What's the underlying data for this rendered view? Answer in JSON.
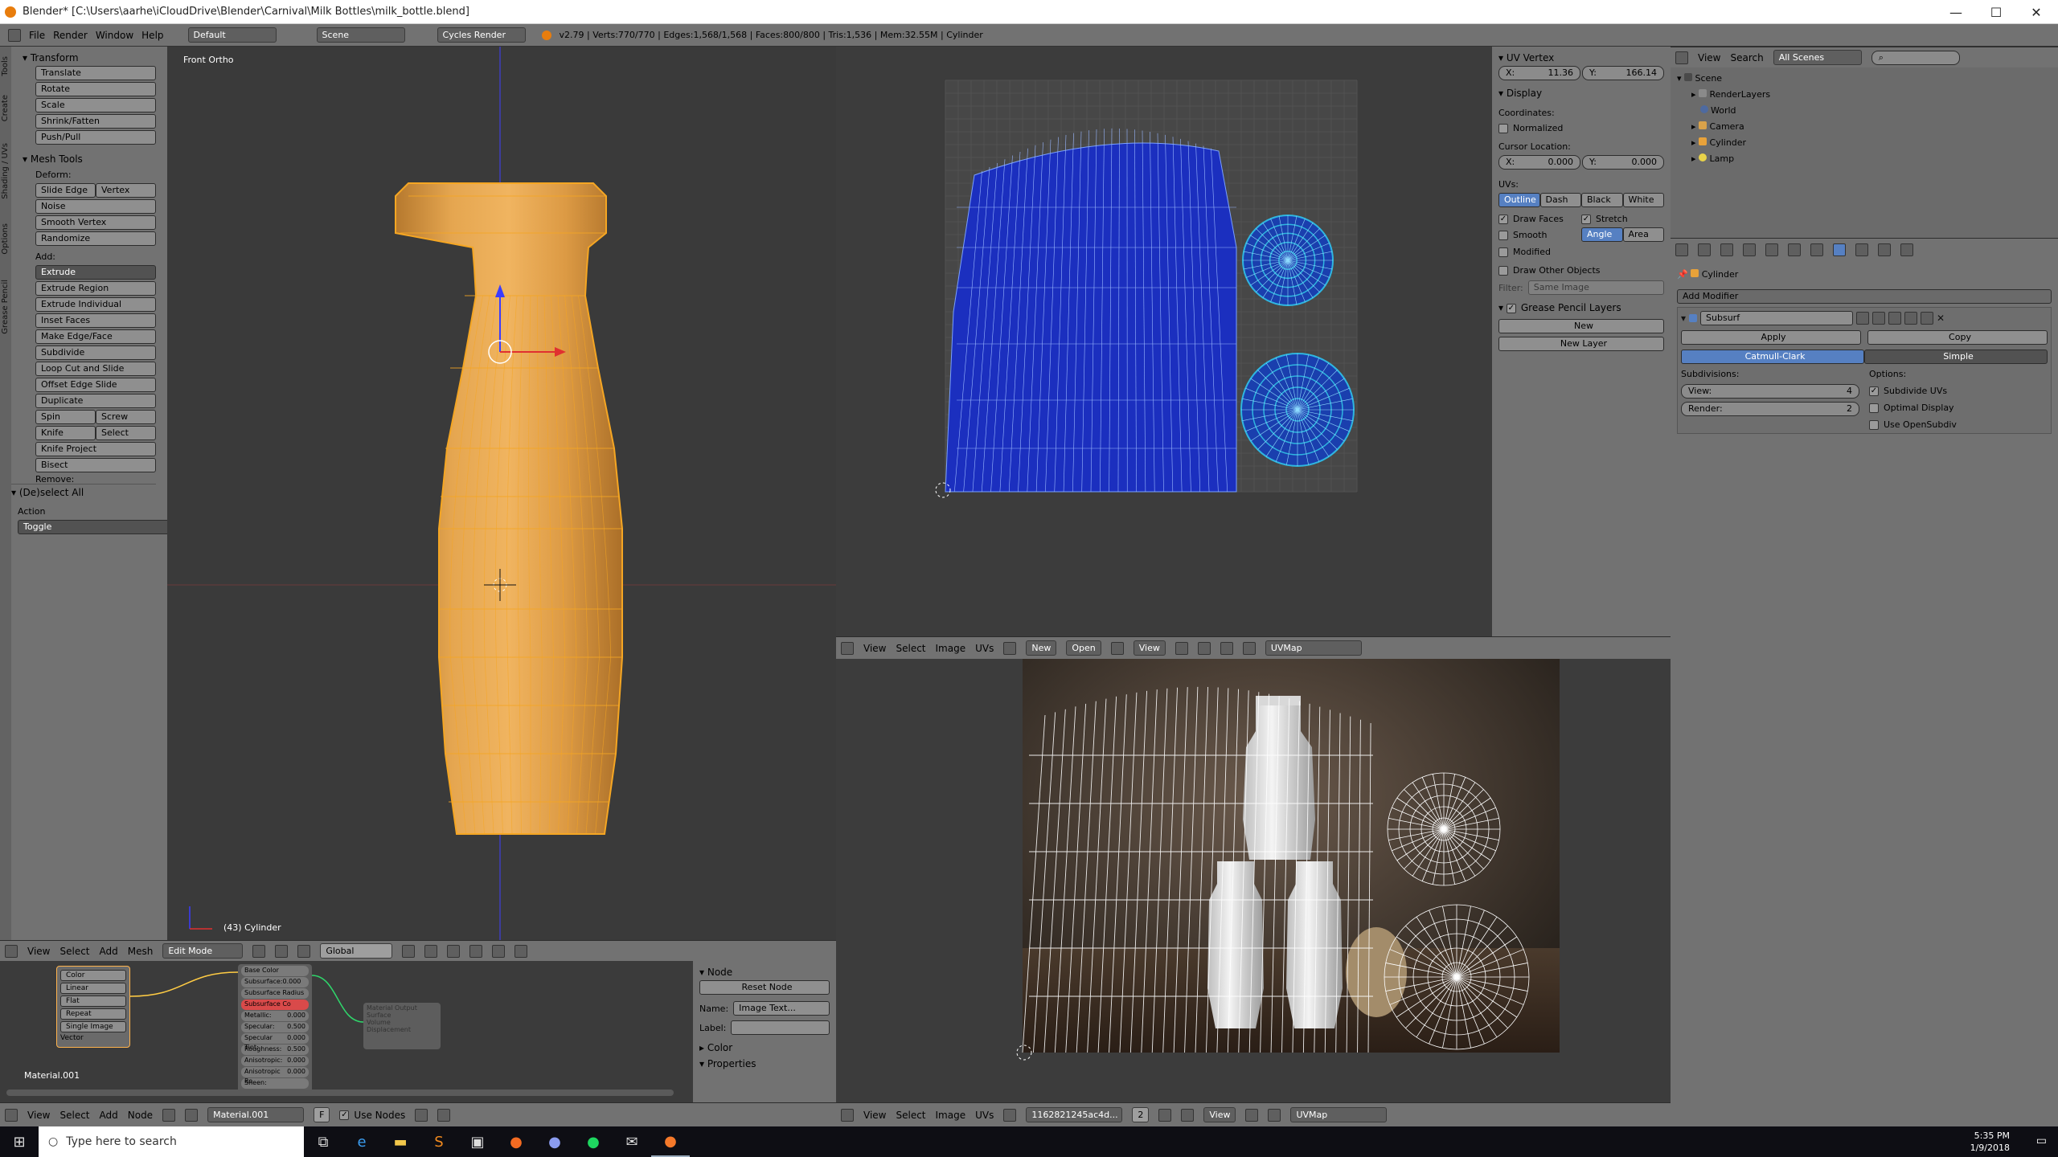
{
  "window": {
    "title": "Blender* [C:\\Users\\aarhe\\iCloudDrive\\Blender\\Carnival\\Milk Bottles\\milk_bottle.blend]",
    "minimize": "—",
    "maximize": "☐",
    "close": "✕"
  },
  "infobar": {
    "menus": [
      "File",
      "Render",
      "Window",
      "Help"
    ],
    "layout": "Default",
    "scene": "Scene",
    "engine": "Cycles Render",
    "stats": "v2.79 | Verts:770/770 | Edges:1,568/1,568 | Faces:800/800 | Tris:1,536 | Mem:32.55M | Cylinder"
  },
  "tool_shelf": {
    "tabs": [
      "Tools",
      "Create",
      "Shading / UVs",
      "Options",
      "Grease Pencil"
    ],
    "transform_header": "Transform",
    "transform_items": [
      "Translate",
      "Rotate",
      "Scale",
      "Shrink/Fatten",
      "Push/Pull"
    ],
    "mesh_tools_header": "Mesh Tools",
    "deform_label": "Deform:",
    "slide_edge": "Slide Edge",
    "vertex": "Vertex",
    "deform_items": [
      "Noise",
      "Smooth Vertex",
      "Randomize"
    ],
    "add_label": "Add:",
    "extrude": "Extrude",
    "add_items": [
      "Extrude Region",
      "Extrude Individual",
      "Inset Faces",
      "Make Edge/Face",
      "Subdivide",
      "Loop Cut and Slide",
      "Offset Edge Slide",
      "Duplicate"
    ],
    "spin": "Spin",
    "screw": "Screw",
    "knife": "Knife",
    "select": "Select",
    "knife_project": "Knife Project",
    "bisect": "Bisect",
    "remove": "Remove:",
    "operator_header": "(De)select All",
    "action_label": "Action",
    "action_value": "Toggle"
  },
  "viewport3d": {
    "view_label": "Front Ortho",
    "object_label": "(43) Cylinder",
    "header_menus": [
      "View",
      "Select",
      "Add",
      "Mesh"
    ],
    "mode": "Edit Mode",
    "orientation": "Global"
  },
  "uv_props": {
    "uv_vertex_header": "UV Vertex",
    "x_label": "X:",
    "x_value": "11.36",
    "y_label": "Y:",
    "y_value": "166.14",
    "display_header": "Display",
    "coordinates_label": "Coordinates:",
    "normalized": "Normalized",
    "cursor_label": "Cursor Location:",
    "cursor_x": "0.000",
    "cursor_y": "0.000",
    "uvs_label": "UVs:",
    "uv_styles": [
      "Outline",
      "Dash",
      "Black",
      "White"
    ],
    "draw_faces": "Draw Faces",
    "stretch": "Stretch",
    "smooth": "Smooth",
    "angle": "Angle",
    "area": "Area",
    "modified": "Modified",
    "draw_other": "Draw Other Objects",
    "filter_label": "Filter:",
    "filter_value": "Same Image",
    "gp_header": "Grease Pencil Layers",
    "new": "New",
    "new_layer": "New Layer"
  },
  "uv_editor_header": {
    "menus": [
      "View",
      "Select",
      "Image",
      "UVs"
    ],
    "new": "New",
    "open": "Open",
    "view": "View",
    "uvmap": "UVMap"
  },
  "render_editor_header": {
    "menus": [
      "View",
      "Select",
      "Image",
      "UVs"
    ],
    "image_name": "1162821245ac4d...",
    "slot": "2",
    "view": "View",
    "uvmap": "UVMap"
  },
  "outliner": {
    "menus": [
      "View",
      "Search"
    ],
    "filter": "All Scenes",
    "items": [
      "Scene",
      "RenderLayers",
      "World",
      "Camera",
      "Cylinder",
      "Lamp"
    ]
  },
  "properties": {
    "object_name": "Cylinder",
    "add_modifier": "Add Modifier",
    "modifier_name": "Subsurf",
    "apply": "Apply",
    "copy": "Copy",
    "catmull": "Catmull-Clark",
    "simple": "Simple",
    "subdivisions_label": "Subdivisions:",
    "options_label": "Options:",
    "view_label": "View:",
    "view_value": "4",
    "render_label": "Render:",
    "render_value": "2",
    "subdivide_uvs": "Subdivide UVs",
    "optimal_display": "Optimal Display",
    "use_opensubdiv": "Use OpenSubdiv"
  },
  "node_editor": {
    "material_label": "Material.001",
    "tex_items": [
      "Color",
      "Linear",
      "Flat",
      "Repeat",
      "Single Image"
    ],
    "vector": "Vector",
    "bsdf_items": [
      "Base Color",
      "Subsurface:0.000",
      "Subsurface Radius",
      "Subsurface Co",
      "Metallic:",
      "Specular:",
      "Specular Tint:",
      "Roughness:",
      "Anisotropic:",
      "Anisotropic Ro",
      "Sheen:"
    ],
    "bsdf_values": [
      "",
      "",
      "",
      "",
      "0.000",
      "0.500",
      "0.000",
      "0.500",
      "0.000",
      "0.000",
      ""
    ],
    "output_items": [
      "Material Output",
      "Surface",
      "Volume",
      "Displacement"
    ],
    "node_header": "Node",
    "reset_node": "Reset Node",
    "name_label": "Name:",
    "name_value": "Image Text...",
    "label_label": "Label:",
    "color_header": "Color",
    "properties_header": "Properties",
    "header_menus": [
      "View",
      "Select",
      "Add",
      "Node"
    ],
    "material_field": "Material.001",
    "material_f": "F",
    "use_nodes": "Use Nodes"
  },
  "taskbar": {
    "search_placeholder": "Type here to search",
    "time": "5:35 PM",
    "date": "1/9/2018"
  },
  "colors": {
    "panel": "#727272",
    "viewport": "#3a3a3a",
    "bottle": "#e3a24a",
    "wire_orange": "#f5a623",
    "uv_blue": "#1b2fbf",
    "uv_cyan": "#2fb6e0",
    "accent_blue": "#5680c2"
  }
}
